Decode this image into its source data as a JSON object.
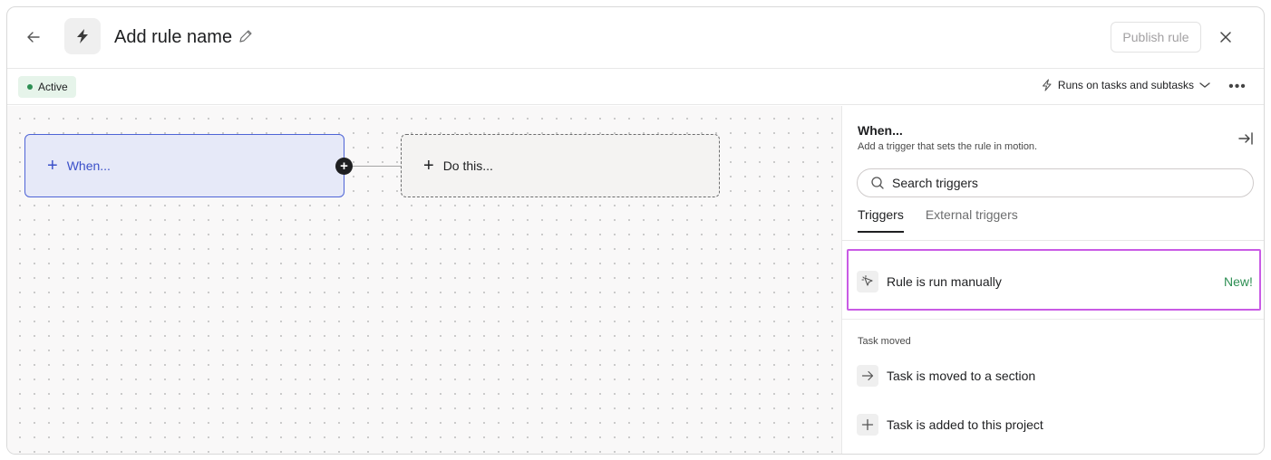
{
  "header": {
    "title": "Add rule name",
    "publish_label": "Publish rule"
  },
  "toolbar": {
    "status": "Active",
    "runs_on": "Runs on tasks and subtasks"
  },
  "canvas": {
    "when_label": "When...",
    "do_label": "Do this..."
  },
  "panel": {
    "title": "When...",
    "subtitle": "Add a trigger that sets the rule in motion.",
    "search_placeholder": "Search triggers",
    "tabs": [
      {
        "label": "Triggers",
        "active": true
      },
      {
        "label": "External triggers",
        "active": false
      }
    ],
    "highlighted_trigger": {
      "label": "Rule is run manually",
      "badge": "New!"
    },
    "section_label": "Task moved",
    "triggers": [
      {
        "label": "Task is moved to a section",
        "icon": "arrow-right-icon"
      },
      {
        "label": "Task is added to this project",
        "icon": "plus-icon"
      }
    ]
  },
  "colors": {
    "accent_blue": "#4e64d6",
    "highlight_purple": "#c95be5",
    "active_green": "#2d8f53"
  }
}
